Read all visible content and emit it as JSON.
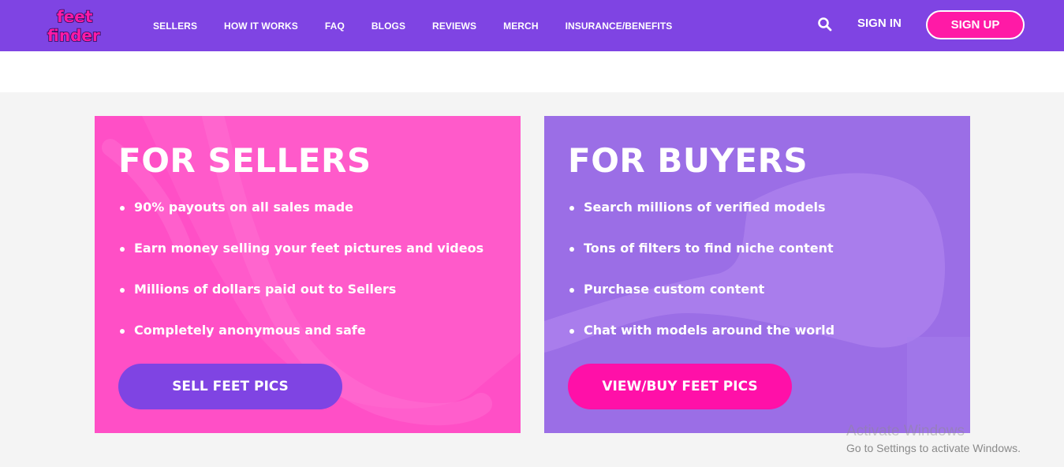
{
  "header": {
    "logo_text": [
      "feet",
      "finder"
    ],
    "nav": [
      "SELLERS",
      "HOW IT WORKS",
      "FAQ",
      "BLOGS",
      "REVIEWS",
      "MERCH",
      "INSURANCE/BENEFITS"
    ],
    "search_icon": "search-icon",
    "signin_label": "SIGN IN",
    "signup_label": "SIGN UP"
  },
  "sellers": {
    "title": "FOR SELLERS",
    "bullets": [
      "90% payouts on all sales made",
      "Earn money selling your feet pictures and videos",
      "Millions of dollars paid out to Sellers",
      "Completely anonymous and safe"
    ],
    "button_label": "SELL FEET PICS"
  },
  "buyers": {
    "title": "FOR BUYERS",
    "bullets": [
      "Search millions of verified models",
      "Tons of filters to find niche content",
      "Purchase custom content",
      "Chat with models around the world"
    ],
    "button_label": "VIEW/BUY FEET PICS"
  },
  "watermark": {
    "title": "Activate Windows",
    "subtitle": "Go to Settings to activate Windows."
  },
  "colors": {
    "nav_bg": "#7f44e3",
    "signup_bg": "#ff1aa6",
    "sellers_bg": "#ff4fc6",
    "buyers_bg": "#9b6ee6",
    "sell_button": "#7f44e3",
    "buy_button": "#ff10a8"
  }
}
